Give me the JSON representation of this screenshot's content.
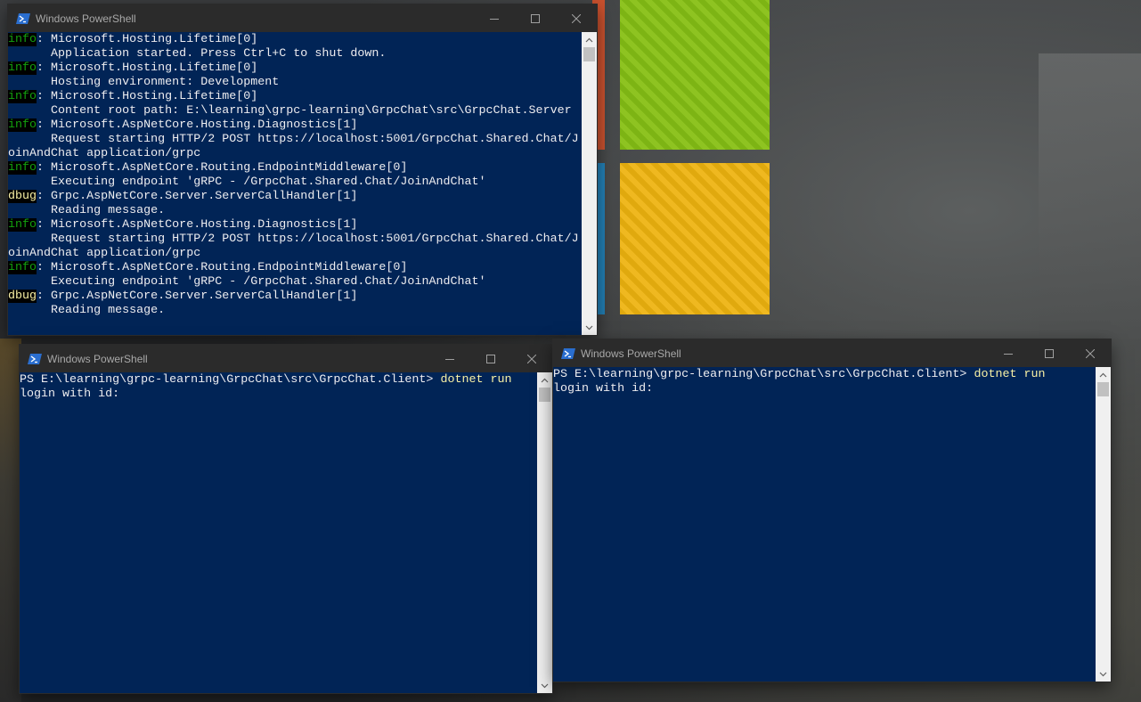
{
  "desktop": {
    "logo_colors": {
      "red": "#e0542a",
      "green": "#7db414",
      "blue": "#1a8fd2",
      "yellow": "#e0a90e"
    }
  },
  "colors": {
    "console_bg": "#012456",
    "console_text": "#eeedf0",
    "info_level": "#13a10e",
    "dbug_level": "#f9f1a5",
    "command_text": "#f9f1a5",
    "titlebar_bg": "#2b2b2b"
  },
  "server_window": {
    "title": "Windows PowerShell",
    "icon": "powershell-icon",
    "controls": [
      "minimize-icon",
      "maximize-icon",
      "close-icon"
    ],
    "lines": [
      {
        "level": "info",
        "text": ": Microsoft.Hosting.Lifetime[0]"
      },
      {
        "level": "",
        "text": "      Application started. Press Ctrl+C to shut down."
      },
      {
        "level": "info",
        "text": ": Microsoft.Hosting.Lifetime[0]"
      },
      {
        "level": "",
        "text": "      Hosting environment: Development"
      },
      {
        "level": "info",
        "text": ": Microsoft.Hosting.Lifetime[0]"
      },
      {
        "level": "",
        "text": "      Content root path: E:\\learning\\grpc-learning\\GrpcChat\\src\\GrpcChat.Server"
      },
      {
        "level": "info",
        "text": ": Microsoft.AspNetCore.Hosting.Diagnostics[1]"
      },
      {
        "level": "",
        "text": "      Request starting HTTP/2 POST https://localhost:5001/GrpcChat.Shared.Chat/J"
      },
      {
        "level": "",
        "text": "oinAndChat application/grpc"
      },
      {
        "level": "info",
        "text": ": Microsoft.AspNetCore.Routing.EndpointMiddleware[0]"
      },
      {
        "level": "",
        "text": "      Executing endpoint 'gRPC - /GrpcChat.Shared.Chat/JoinAndChat'"
      },
      {
        "level": "dbug",
        "text": ": Grpc.AspNetCore.Server.ServerCallHandler[1]"
      },
      {
        "level": "",
        "text": "      Reading message."
      },
      {
        "level": "info",
        "text": ": Microsoft.AspNetCore.Hosting.Diagnostics[1]"
      },
      {
        "level": "",
        "text": "      Request starting HTTP/2 POST https://localhost:5001/GrpcChat.Shared.Chat/J"
      },
      {
        "level": "",
        "text": "oinAndChat application/grpc"
      },
      {
        "level": "info",
        "text": ": Microsoft.AspNetCore.Routing.EndpointMiddleware[0]"
      },
      {
        "level": "",
        "text": "      Executing endpoint 'gRPC - /GrpcChat.Shared.Chat/JoinAndChat'"
      },
      {
        "level": "dbug",
        "text": ": Grpc.AspNetCore.Server.ServerCallHandler[1]"
      },
      {
        "level": "",
        "text": "      Reading message."
      }
    ]
  },
  "client_window_1": {
    "title": "Windows PowerShell",
    "icon": "powershell-icon",
    "controls": [
      "minimize-icon",
      "maximize-icon",
      "close-icon"
    ],
    "prompt": "PS E:\\learning\\grpc-learning\\GrpcChat\\src\\GrpcChat.Client> ",
    "command": "dotnet run",
    "output": "login with id:"
  },
  "client_window_2": {
    "title": "Windows PowerShell",
    "icon": "powershell-icon",
    "controls": [
      "minimize-icon",
      "maximize-icon",
      "close-icon"
    ],
    "prompt": "PS E:\\learning\\grpc-learning\\GrpcChat\\src\\GrpcChat.Client> ",
    "command": "dotnet run",
    "output": "login with id:"
  }
}
